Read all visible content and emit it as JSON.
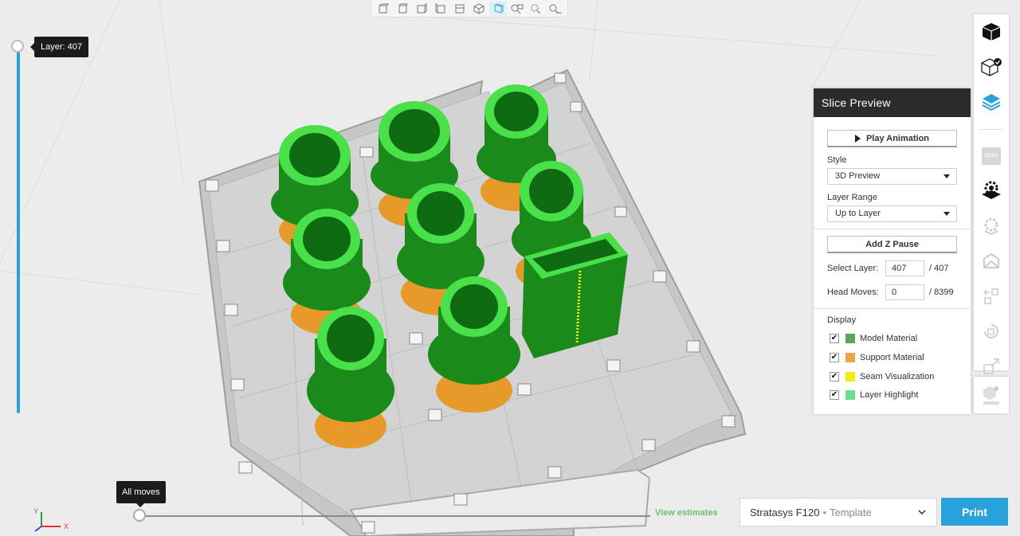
{
  "viewport": {
    "layer_tooltip": "Layer: 407",
    "moves_tooltip": "All moves",
    "view_estimates": "View estimates",
    "axis": {
      "y": "Y",
      "x": "X"
    }
  },
  "view_toolbar": {
    "icons": [
      "front-view-icon",
      "back-view-icon",
      "left-view-icon",
      "right-view-icon",
      "top-view-icon",
      "iso-view-icon",
      "perspective-icon",
      "zoom-fit-icon",
      "zoom-selection-icon",
      "measure-icon"
    ]
  },
  "slice_panel": {
    "title": "Slice Preview",
    "play_label": "Play Animation",
    "style_label": "Style",
    "style_value": "3D Preview",
    "range_label": "Layer Range",
    "range_value": "Up to Layer",
    "z_pause_label": "Add Z Pause",
    "select_layer_label": "Select Layer:",
    "select_layer_value": "407",
    "select_layer_total": "/ 407",
    "head_moves_label": "Head Moves:",
    "head_moves_value": "0",
    "head_moves_total": "/ 8399",
    "display_label": "Display",
    "display_items": [
      {
        "label": "Model Material",
        "color": "#5fa35f",
        "checked": "✔"
      },
      {
        "label": "Support Material",
        "color": "#f0a34a",
        "checked": "✔"
      },
      {
        "label": "Seam Visualization",
        "color": "#f3ec11",
        "checked": "✔"
      },
      {
        "label": "Layer Highlight",
        "color": "#6ede8a",
        "checked": "✔"
      }
    ]
  },
  "tools": {
    "mm_label": "mm"
  },
  "printer": {
    "name": "Stratasys F120",
    "separator": "•",
    "template": "Template",
    "print_label": "Print"
  },
  "colors": {
    "accent": "#29a1db",
    "model_green": "#1a8a1a",
    "highlight_green": "#4ae04a",
    "support_orange": "#e79a2a"
  }
}
